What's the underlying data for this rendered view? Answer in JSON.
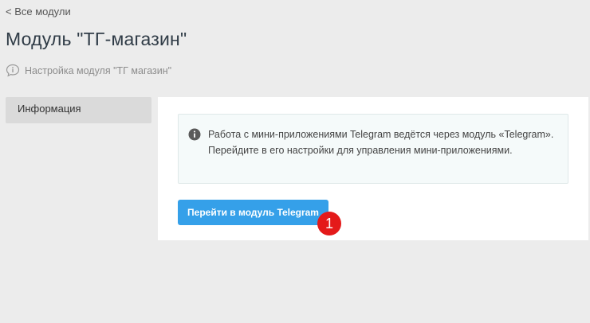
{
  "nav": {
    "back_label": "< Все модули"
  },
  "header": {
    "title": "Модуль \"ТГ-магазин\"",
    "subtitle": "Настройка модуля \"ТГ магазин\"",
    "subtitle_icon": "speech-info-icon"
  },
  "sidebar": {
    "items": [
      {
        "label": "Информация",
        "active": true
      }
    ]
  },
  "main": {
    "info": {
      "icon": "info-circle-icon",
      "text": "Работа с мини-приложениями Telegram ведётся через модуль «Telegram». Перейдите в его настройки для управления мини-приложениями."
    },
    "button_label": "Перейти в модуль Telegram",
    "button_color": "#35a0e9"
  },
  "annotation": {
    "marker_label": "1",
    "marker_color": "#e41a1a"
  }
}
